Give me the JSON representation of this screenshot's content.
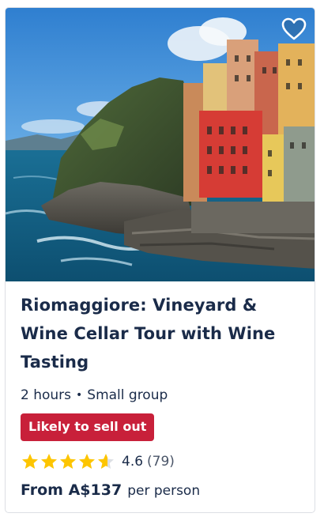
{
  "card": {
    "image_alt": "Riomaggiore coastline with colorful houses",
    "wishlist_icon": "heart-outline-icon",
    "title": "Riomaggiore: Vineyard & Wine Cellar Tour with Wine Tasting",
    "duration": "2 hours",
    "separator": "•",
    "group": "Small group",
    "badge": "Likely to sell out",
    "rating": {
      "value": "4.6",
      "count": "(79)",
      "stars_filled": 4.6,
      "stars_total": 5,
      "star_color": "#fdc500",
      "star_empty_color": "#dcdfe4"
    },
    "price": {
      "from": "From A$137",
      "unit": "per person"
    },
    "colors": {
      "text": "#1a2b49",
      "badge_bg": "#c8203a",
      "border": "#dcdfe4"
    }
  }
}
